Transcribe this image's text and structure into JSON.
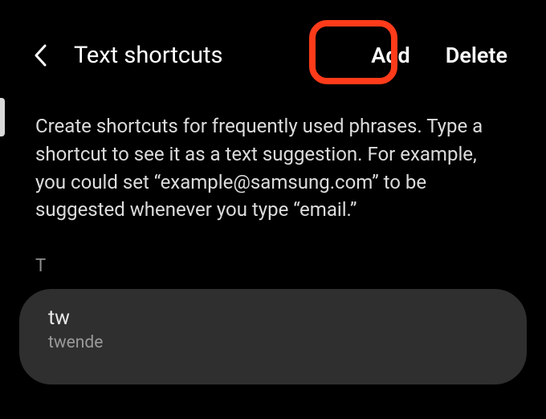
{
  "header": {
    "title": "Text shortcuts",
    "add_label": "Add",
    "delete_label": "Delete"
  },
  "description": "Create shortcuts for frequently used phrases. Type a shortcut to see it as a text suggestion. For example, you could set “example@samsung.com” to be suggested whenever you type “email.”",
  "list": {
    "section_letter": "T",
    "items": [
      {
        "shortcut": "tw",
        "phrase": "twende"
      }
    ]
  }
}
